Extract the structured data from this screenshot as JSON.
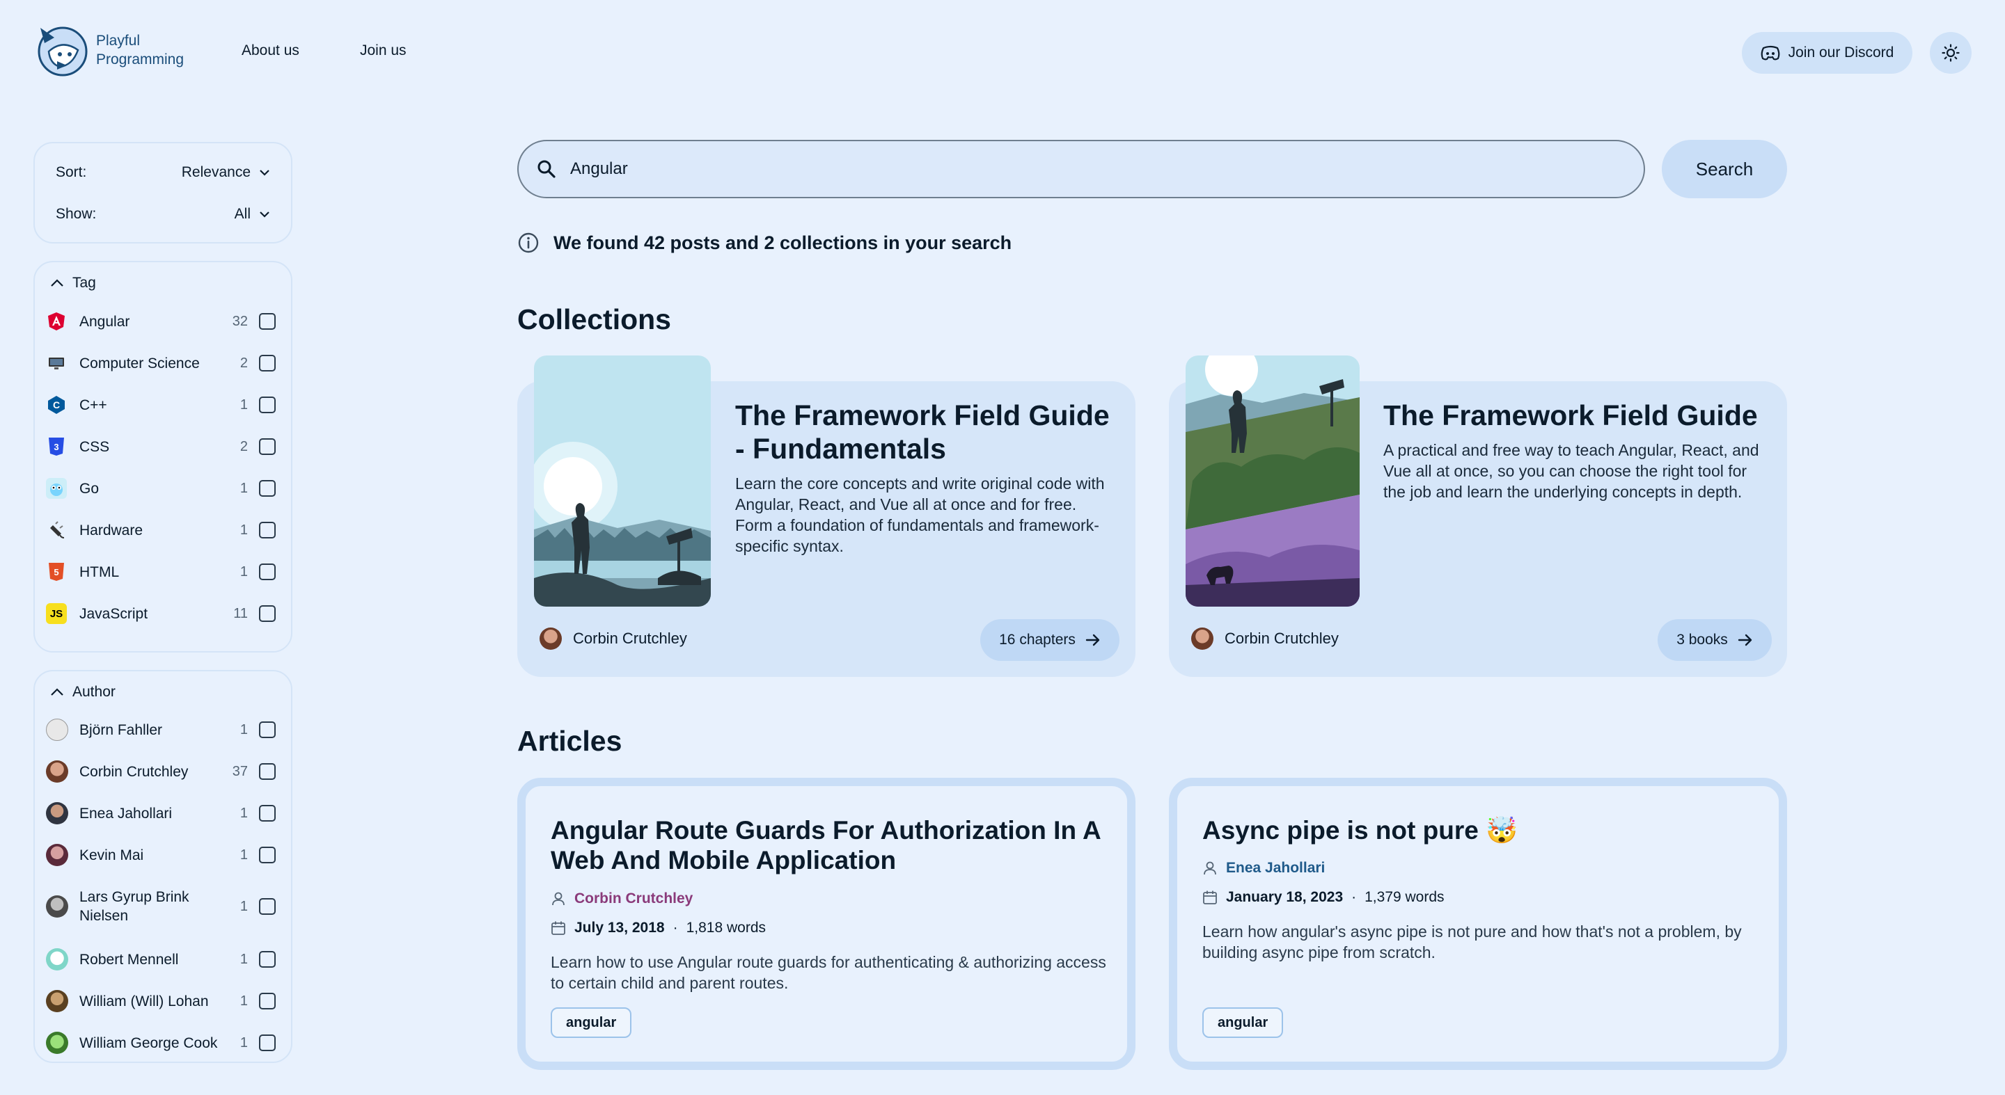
{
  "header": {
    "logo_line1": "Playful",
    "logo_line2": "Programming",
    "nav": [
      "About us",
      "Join us"
    ],
    "discord_label": "Join our Discord",
    "theme_icon": "sun-icon"
  },
  "filters": {
    "sort_label": "Sort:",
    "sort_value": "Relevance",
    "show_label": "Show:",
    "show_value": "All"
  },
  "tag_facet": {
    "title": "Tag",
    "items": [
      {
        "label": "Angular",
        "count": "32",
        "icon": "angular-icon",
        "color": "#dd0031"
      },
      {
        "label": "Computer Science",
        "count": "2",
        "icon": "monitor-icon",
        "color": "#333333"
      },
      {
        "label": "C++",
        "count": "1",
        "icon": "cpp-icon",
        "color": "#00599c"
      },
      {
        "label": "CSS",
        "count": "2",
        "icon": "css-icon",
        "color": "#264de4"
      },
      {
        "label": "Go",
        "count": "1",
        "icon": "go-gopher-icon",
        "color": "#00add8"
      },
      {
        "label": "Hardware",
        "count": "1",
        "icon": "plug-icon",
        "color": "#333333"
      },
      {
        "label": "HTML",
        "count": "1",
        "icon": "html-icon",
        "color": "#e34f26"
      },
      {
        "label": "JavaScript",
        "count": "11",
        "icon": "javascript-icon",
        "color": "#f7df1e"
      }
    ]
  },
  "author_facet": {
    "title": "Author",
    "items": [
      {
        "label": "Björn Fahller",
        "count": "1"
      },
      {
        "label": "Corbin Crutchley",
        "count": "37"
      },
      {
        "label": "Enea Jahollari",
        "count": "1"
      },
      {
        "label": "Kevin Mai",
        "count": "1"
      },
      {
        "label": "Lars Gyrup Brink Nielsen",
        "count": "1"
      },
      {
        "label": "Robert Mennell",
        "count": "1"
      },
      {
        "label": "William (Will) Lohan",
        "count": "1"
      },
      {
        "label": "William George Cook",
        "count": "1"
      }
    ]
  },
  "search": {
    "value": "Angular",
    "button_label": "Search",
    "result_note": "We found 42 posts and 2 collections in your search"
  },
  "collections": {
    "heading": "Collections",
    "items": [
      {
        "title": "The Framework Field Guide - Fundamentals",
        "description": "Learn the core concepts and write original code with Angular, React, and Vue all at once and for free. Form a foundation of fundamentals and framework-specific syntax.",
        "author": "Corbin Crutchley",
        "button": "16 chapters"
      },
      {
        "title": "The Framework Field Guide",
        "description": "A practical and free way to teach Angular, React, and Vue all at once, so you can choose the right tool for the job and learn the underlying concepts in depth.",
        "author": "Corbin Crutchley",
        "button": "3 books"
      }
    ]
  },
  "articles": {
    "heading": "Articles",
    "items": [
      {
        "title": "Angular Route Guards For Authorization In A Web And Mobile Application",
        "author": "Corbin Crutchley",
        "date": "July 13, 2018",
        "words": "1,818 words",
        "description": "Learn how to use Angular route guards for authenticating & authorizing access to certain child and parent routes.",
        "tag": "angular"
      },
      {
        "title": "Async pipe is not pure 🤯",
        "author": "Enea Jahollari",
        "date": "January 18, 2023",
        "words": "1,379 words",
        "description": "Learn how angular's async pipe is not pure and how that's not a problem, by building async pipe from scratch.",
        "tag": "angular"
      }
    ]
  }
}
